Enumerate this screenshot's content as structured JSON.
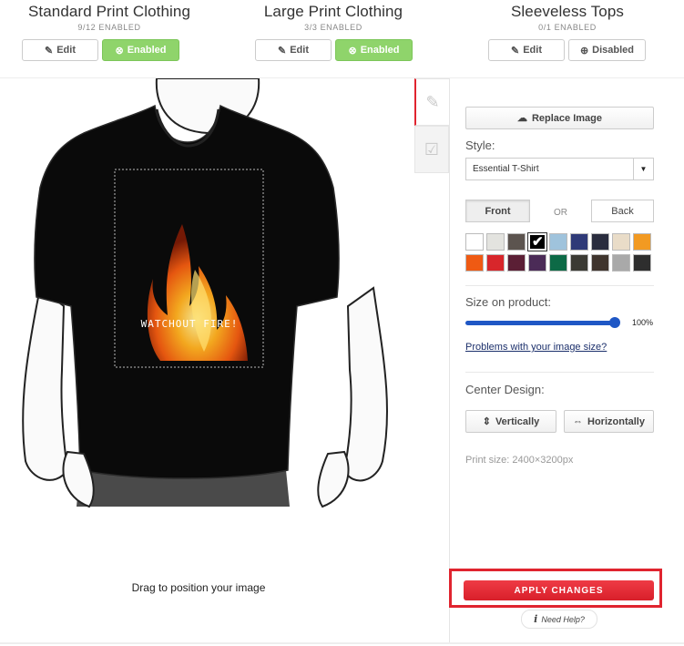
{
  "products": [
    {
      "title": "Standard Print Clothing",
      "count": "9/12 ENABLED",
      "edit_label": "Edit",
      "status_label": "Enabled",
      "status": "enabled"
    },
    {
      "title": "Large Print Clothing",
      "count": "3/3 ENABLED",
      "edit_label": "Edit",
      "status_label": "Enabled",
      "status": "enabled"
    },
    {
      "title": "Sleeveless Tops",
      "count": "0/1 ENABLED",
      "edit_label": "Edit",
      "status_label": "Disabled",
      "status": "disabled"
    }
  ],
  "preview": {
    "design_text": "WATCHOUT FIRE!",
    "drag_hint": "Drag to position your image"
  },
  "tabs": [
    {
      "icon": "pencil-icon",
      "active": true
    },
    {
      "icon": "checkbox-info-icon",
      "active": false
    }
  ],
  "panel": {
    "replace_label": "Replace Image",
    "style_label": "Style:",
    "style_value": "Essential T-Shirt",
    "front_label": "Front",
    "or_label": "OR",
    "back_label": "Back",
    "swatches": [
      "#ffffff",
      "#e3e3df",
      "#5c544f",
      "#000000",
      "#9fc3dc",
      "#2f3a78",
      "#2a2d3e",
      "#e9dcc8",
      "#f29a22",
      "#ef5a13",
      "#d8262b",
      "#5b1f35",
      "#4b2b57",
      "#0d6a46",
      "#3b3a34",
      "#3f342d",
      "#a9a9a9",
      "#2e2e2e"
    ],
    "selected_swatch": 3,
    "size_label": "Size on product:",
    "size_value": "100%",
    "size_fraction": 1.0,
    "problems_link": "Problems with your image size?",
    "center_label": "Center Design:",
    "vertically_label": "Vertically",
    "horizontally_label": "Horizontally",
    "print_size": "Print size: 2400×3200px",
    "apply_label": "APPLY CHANGES",
    "help_label": "Need Help?"
  },
  "colors": {
    "enabled_green": "#8fd46b",
    "accent_red": "#e0242f",
    "slider_blue": "#1f57c5"
  }
}
